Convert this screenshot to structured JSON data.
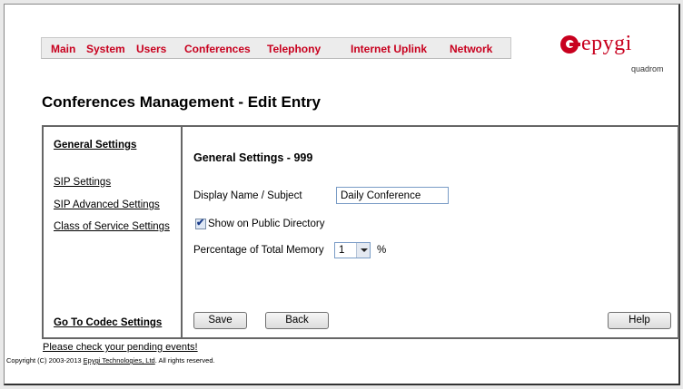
{
  "nav": {
    "items": [
      {
        "label": "Main"
      },
      {
        "label": "System"
      },
      {
        "label": "Users"
      },
      {
        "label": "Conferences"
      },
      {
        "label": "Telephony"
      },
      {
        "label": "Internet Uplink"
      },
      {
        "label": "Network"
      }
    ]
  },
  "logo": {
    "brand": "epygi",
    "mark_icon": "epygi-logo-icon",
    "sub": "quadrom",
    "color": "#c8001e"
  },
  "page_title": "Conferences Management - Edit Entry",
  "sidebar": {
    "general": "General Settings",
    "sip": "SIP Settings",
    "sip_advanced": "SIP Advanced Settings",
    "class_of_service": "Class of Service Settings",
    "codec": "Go To Codec Settings"
  },
  "form": {
    "section_title": "General Settings - 999",
    "display_name_label": "Display Name / Subject",
    "display_name_value": "Daily Conference",
    "show_public_label": "Show on Public Directory",
    "show_public_checked": true,
    "memory_label": "Percentage of Total Memory",
    "memory_value": "1",
    "memory_unit": "%"
  },
  "buttons": {
    "save": "Save",
    "back": "Back",
    "help": "Help"
  },
  "footer": {
    "pending": "Please check your pending events!",
    "copyright_prefix": "Copyright (C) 2003-2013 ",
    "copyright_company": "Epygi Technologies, Ltd",
    "copyright_suffix": ". All rights reserved."
  },
  "colors": {
    "accent": "#c8001e",
    "nav_bg": "#ececec",
    "border": "#666666"
  }
}
